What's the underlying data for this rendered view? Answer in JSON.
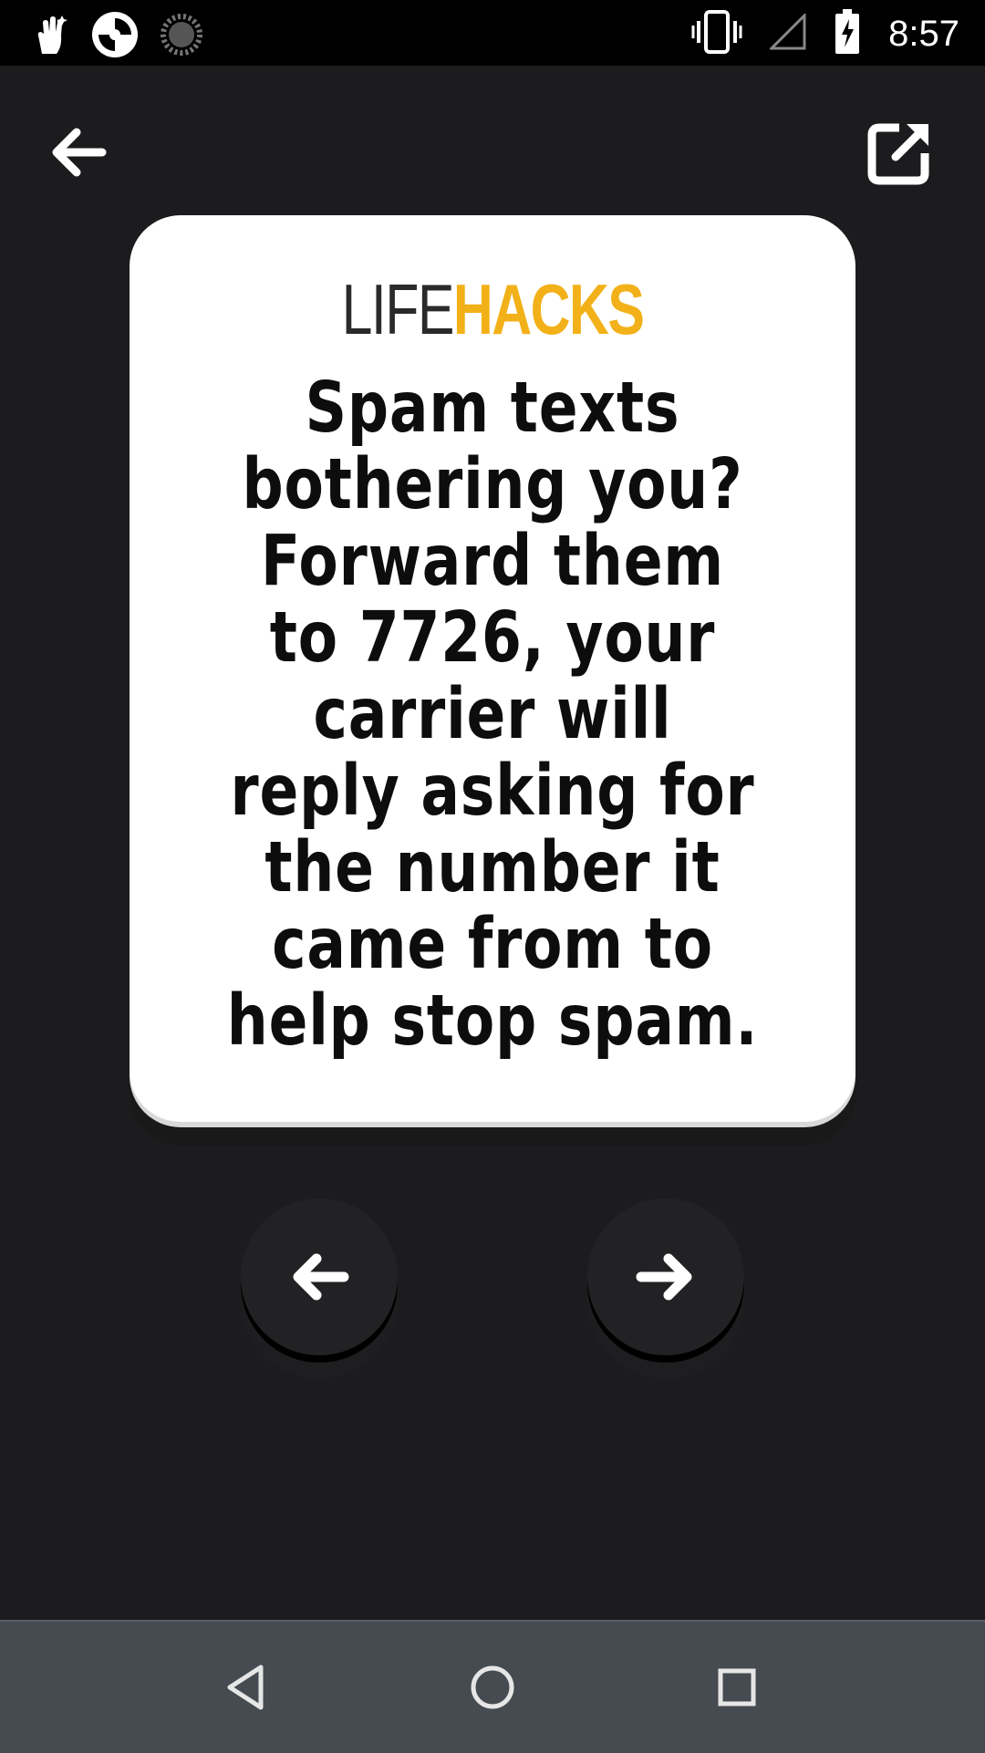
{
  "status_bar": {
    "time": "8:57",
    "icons": [
      "hand-wave-icon",
      "camera-aperture-icon",
      "sync-spinner-icon",
      "vibrate-icon",
      "signal-icon",
      "battery-charging-icon"
    ]
  },
  "top_bar": {
    "back_icon": "arrow-left-icon",
    "share_icon": "share-external-icon"
  },
  "card": {
    "brand_life": "LIFE",
    "brand_hacks": "HACKS",
    "hack_text": "Spam texts bothering you? Forward them to 7726, your carrier will reply asking for the number it came from to help stop spam."
  },
  "navigation": {
    "prev_icon": "arrow-left-icon",
    "next_icon": "arrow-right-icon"
  },
  "system_nav": {
    "back": "triangle-back-icon",
    "home": "circle-home-icon",
    "recents": "square-recents-icon"
  },
  "colors": {
    "background": "#1c1c1e",
    "card": "#ffffff",
    "accent": "#f2b118",
    "nav_bar": "#464b51"
  }
}
